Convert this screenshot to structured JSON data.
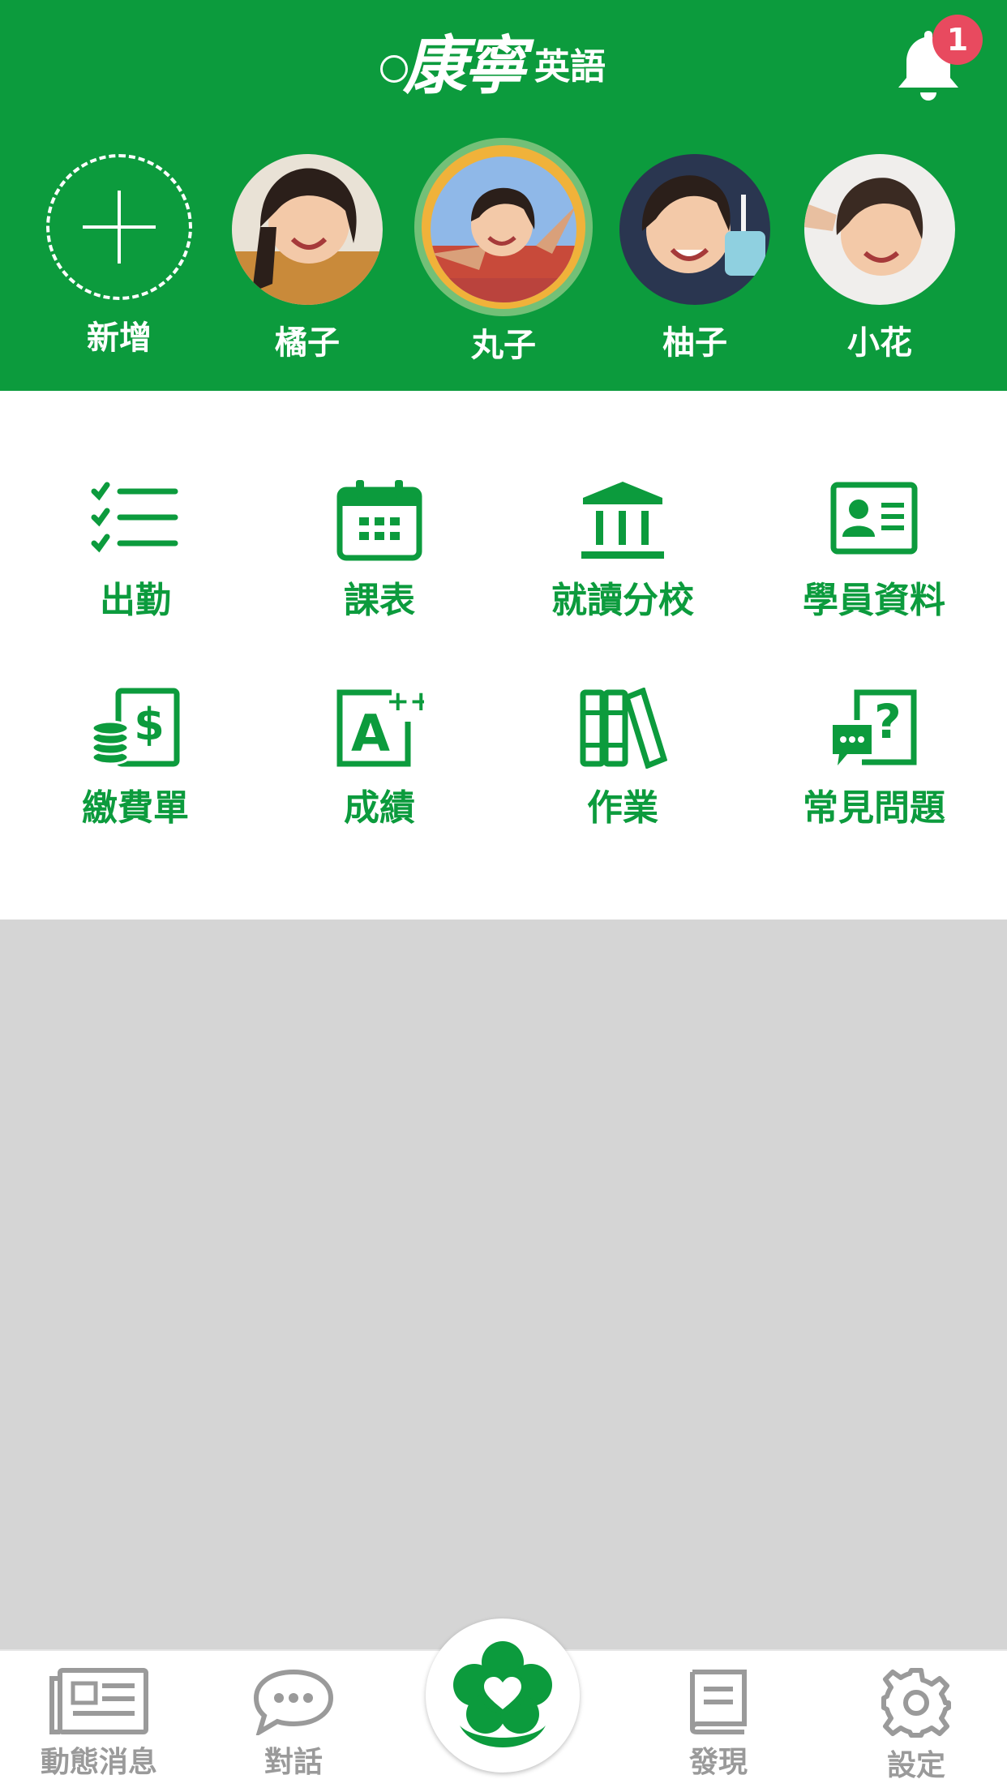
{
  "header": {
    "logo_text": "康寧英語",
    "notification_count": "1",
    "accent_color": "#0c9b3d",
    "badge_color": "#e84a5f"
  },
  "profiles": [
    {
      "name": "新增",
      "icon": "plus-icon"
    },
    {
      "name": "橘子",
      "icon": "avatar"
    },
    {
      "name": "丸子",
      "icon": "avatar",
      "selected": true
    },
    {
      "name": "柚子",
      "icon": "avatar"
    },
    {
      "name": "小花",
      "icon": "avatar"
    }
  ],
  "menu": {
    "items": [
      {
        "label": "出勤",
        "icon": "checklist-icon"
      },
      {
        "label": "課表",
        "icon": "calendar-icon"
      },
      {
        "label": "就讀分校",
        "icon": "school-building-icon"
      },
      {
        "label": "學員資料",
        "icon": "id-card-icon"
      },
      {
        "label": "繳費單",
        "icon": "bill-coins-icon"
      },
      {
        "label": "成績",
        "icon": "grade-icon"
      },
      {
        "label": "作業",
        "icon": "books-icon"
      },
      {
        "label": "常見問題",
        "icon": "faq-icon"
      }
    ]
  },
  "tabbar": {
    "items": [
      {
        "label": "動態消息",
        "icon": "newspaper-icon"
      },
      {
        "label": "對話",
        "icon": "chat-bubble-icon"
      },
      {
        "label": "",
        "icon": "flower-heart-logo-icon"
      },
      {
        "label": "發現",
        "icon": "book-icon"
      },
      {
        "label": "設定",
        "icon": "gear-icon"
      }
    ],
    "inactive_color": "#9a9a9a"
  }
}
